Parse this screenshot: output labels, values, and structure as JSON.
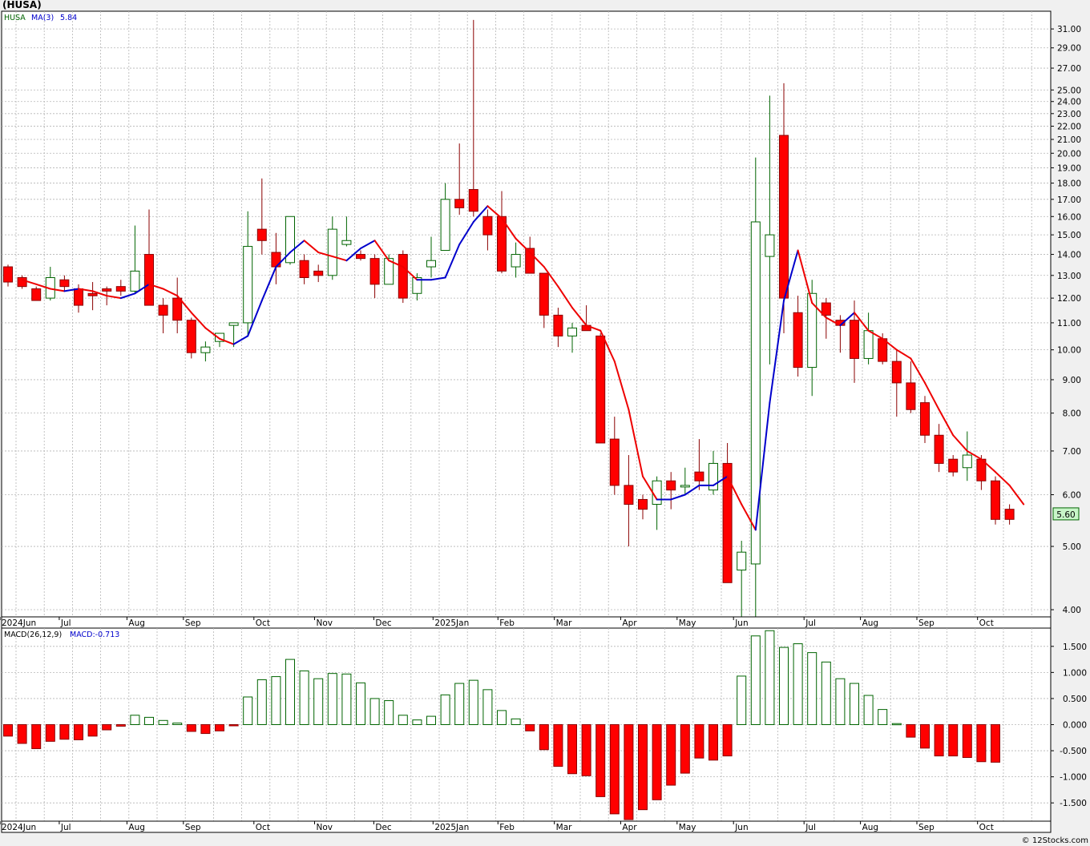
{
  "header": {
    "ticker_title": "(HUSA)"
  },
  "footer": {
    "copyright": "© 12Stocks.com"
  },
  "colors": {
    "up": "#006400",
    "down": "#ff0000",
    "ma_up": "#0000cc",
    "ma_down": "#ee0000",
    "grid": "#b5b5b5",
    "bg": "#ffffff"
  },
  "chart_data": [
    {
      "type": "candlestick",
      "legend": {
        "symbol": "HUSA",
        "ma_label": "MA(3)",
        "ma_value": "5.84"
      },
      "last_price_label": "5.60",
      "scale": "log",
      "ylim": [
        3.9,
        33
      ],
      "y_ticks": [
        "4.00",
        "5.00",
        "6.00",
        "7.00",
        "8.00",
        "9.00",
        "10.00",
        "11.00",
        "12.00",
        "13.00",
        "14.00",
        "15.00",
        "16.00",
        "17.00",
        "18.00",
        "19.00",
        "20.00",
        "21.00",
        "22.00",
        "23.00",
        "24.00",
        "25.00",
        "27.00",
        "29.00",
        "31.00"
      ],
      "x_labels": [
        "2024Jun",
        "Jul",
        "Aug",
        "Sep",
        "Oct",
        "Nov",
        "Dec",
        "2025Jan",
        "Feb",
        "Mar",
        "Apr",
        "May",
        "Jun",
        "Jul",
        "Aug",
        "Sep",
        "Oct"
      ],
      "candles": [
        {
          "o": 13.4,
          "h": 13.5,
          "l": 12.5,
          "c": 12.7
        },
        {
          "o": 12.9,
          "h": 13.0,
          "l": 12.4,
          "c": 12.5
        },
        {
          "o": 12.4,
          "h": 12.5,
          "l": 11.9,
          "c": 11.9
        },
        {
          "o": 12.0,
          "h": 13.4,
          "l": 11.9,
          "c": 12.9
        },
        {
          "o": 12.8,
          "h": 13.0,
          "l": 12.3,
          "c": 12.5
        },
        {
          "o": 12.4,
          "h": 12.6,
          "l": 11.4,
          "c": 11.7
        },
        {
          "o": 12.2,
          "h": 12.7,
          "l": 11.5,
          "c": 12.1
        },
        {
          "o": 12.4,
          "h": 12.5,
          "l": 11.7,
          "c": 12.3
        },
        {
          "o": 12.5,
          "h": 12.8,
          "l": 12.1,
          "c": 12.3
        },
        {
          "o": 12.3,
          "h": 15.5,
          "l": 12.2,
          "c": 13.2
        },
        {
          "o": 14.0,
          "h": 16.4,
          "l": 11.7,
          "c": 11.7
        },
        {
          "o": 11.7,
          "h": 12.0,
          "l": 10.6,
          "c": 11.3
        },
        {
          "o": 12.0,
          "h": 12.9,
          "l": 10.6,
          "c": 11.1
        },
        {
          "o": 11.1,
          "h": 11.2,
          "l": 9.7,
          "c": 9.9
        },
        {
          "o": 9.9,
          "h": 10.3,
          "l": 9.6,
          "c": 10.1
        },
        {
          "o": 10.3,
          "h": 10.6,
          "l": 10.1,
          "c": 10.6
        },
        {
          "o": 10.9,
          "h": 11.0,
          "l": 10.1,
          "c": 11.0
        },
        {
          "o": 11.0,
          "h": 16.3,
          "l": 10.5,
          "c": 14.4
        },
        {
          "o": 15.3,
          "h": 18.3,
          "l": 14.0,
          "c": 14.7
        },
        {
          "o": 14.1,
          "h": 15.1,
          "l": 12.6,
          "c": 13.4
        },
        {
          "o": 13.6,
          "h": 16.0,
          "l": 13.5,
          "c": 16.0
        },
        {
          "o": 13.7,
          "h": 14.0,
          "l": 12.6,
          "c": 12.9
        },
        {
          "o": 13.2,
          "h": 13.5,
          "l": 12.7,
          "c": 13.0
        },
        {
          "o": 13.0,
          "h": 16.0,
          "l": 12.8,
          "c": 15.3
        },
        {
          "o": 14.5,
          "h": 16.0,
          "l": 14.4,
          "c": 14.7
        },
        {
          "o": 14.0,
          "h": 14.2,
          "l": 13.7,
          "c": 13.8
        },
        {
          "o": 13.8,
          "h": 14.0,
          "l": 12.0,
          "c": 12.6
        },
        {
          "o": 12.6,
          "h": 14.0,
          "l": 12.6,
          "c": 13.8
        },
        {
          "o": 14.0,
          "h": 14.2,
          "l": 11.8,
          "c": 12.0
        },
        {
          "o": 12.2,
          "h": 13.1,
          "l": 11.9,
          "c": 12.9
        },
        {
          "o": 13.4,
          "h": 14.9,
          "l": 12.9,
          "c": 13.7
        },
        {
          "o": 14.2,
          "h": 18.0,
          "l": 14.2,
          "c": 17.0
        },
        {
          "o": 17.0,
          "h": 20.7,
          "l": 16.1,
          "c": 16.5
        },
        {
          "o": 17.6,
          "h": 32.0,
          "l": 16.0,
          "c": 16.3
        },
        {
          "o": 16.0,
          "h": 16.4,
          "l": 14.2,
          "c": 15.0
        },
        {
          "o": 16.0,
          "h": 17.5,
          "l": 13.1,
          "c": 13.2
        },
        {
          "o": 13.4,
          "h": 14.6,
          "l": 12.9,
          "c": 14.0
        },
        {
          "o": 14.3,
          "h": 14.9,
          "l": 13.1,
          "c": 13.1
        },
        {
          "o": 13.1,
          "h": 13.1,
          "l": 10.8,
          "c": 11.3
        },
        {
          "o": 11.3,
          "h": 11.6,
          "l": 10.1,
          "c": 10.5
        },
        {
          "o": 10.5,
          "h": 11.0,
          "l": 9.9,
          "c": 10.8
        },
        {
          "o": 10.9,
          "h": 11.7,
          "l": 10.7,
          "c": 10.7
        },
        {
          "o": 10.5,
          "h": 10.6,
          "l": 7.2,
          "c": 7.2
        },
        {
          "o": 7.3,
          "h": 7.9,
          "l": 6.0,
          "c": 6.2
        },
        {
          "o": 6.2,
          "h": 6.9,
          "l": 5.0,
          "c": 5.8
        },
        {
          "o": 5.9,
          "h": 6.0,
          "l": 5.5,
          "c": 5.7
        },
        {
          "o": 5.8,
          "h": 6.4,
          "l": 5.3,
          "c": 6.3
        },
        {
          "o": 6.3,
          "h": 6.5,
          "l": 5.7,
          "c": 6.1
        },
        {
          "o": 6.2,
          "h": 6.6,
          "l": 6.0,
          "c": 6.2
        },
        {
          "o": 6.5,
          "h": 7.3,
          "l": 6.1,
          "c": 6.3
        },
        {
          "o": 6.1,
          "h": 7.0,
          "l": 6.0,
          "c": 6.7
        },
        {
          "o": 6.7,
          "h": 7.2,
          "l": 4.4,
          "c": 4.4
        },
        {
          "o": 4.6,
          "h": 5.1,
          "l": 3.9,
          "c": 4.9
        },
        {
          "o": 4.7,
          "h": 19.7,
          "l": 3.9,
          "c": 15.7
        },
        {
          "o": 13.9,
          "h": 24.5,
          "l": 9.5,
          "c": 15.0
        },
        {
          "o": 21.3,
          "h": 25.6,
          "l": 10.6,
          "c": 12.0
        },
        {
          "o": 11.4,
          "h": 12.1,
          "l": 9.1,
          "c": 9.4
        },
        {
          "o": 9.4,
          "h": 12.8,
          "l": 8.5,
          "c": 12.2
        },
        {
          "o": 11.8,
          "h": 12.0,
          "l": 10.4,
          "c": 11.3
        },
        {
          "o": 11.1,
          "h": 11.3,
          "l": 9.9,
          "c": 10.9
        },
        {
          "o": 11.1,
          "h": 11.9,
          "l": 8.9,
          "c": 9.7
        },
        {
          "o": 9.7,
          "h": 11.4,
          "l": 9.5,
          "c": 10.7
        },
        {
          "o": 10.4,
          "h": 10.6,
          "l": 9.5,
          "c": 9.6
        },
        {
          "o": 9.6,
          "h": 10.0,
          "l": 7.9,
          "c": 8.9
        },
        {
          "o": 8.9,
          "h": 9.6,
          "l": 8.0,
          "c": 8.1
        },
        {
          "o": 8.3,
          "h": 8.5,
          "l": 7.2,
          "c": 7.4
        },
        {
          "o": 7.4,
          "h": 7.7,
          "l": 6.5,
          "c": 6.7
        },
        {
          "o": 6.8,
          "h": 6.9,
          "l": 6.4,
          "c": 6.5
        },
        {
          "o": 6.6,
          "h": 7.5,
          "l": 6.3,
          "c": 6.9
        },
        {
          "o": 6.8,
          "h": 6.9,
          "l": 6.1,
          "c": 6.3
        },
        {
          "o": 6.3,
          "h": 6.4,
          "l": 5.4,
          "c": 5.5
        },
        {
          "o": 5.7,
          "h": 5.8,
          "l": 5.4,
          "c": 5.5
        }
      ],
      "ma": [
        12.8,
        12.6,
        12.4,
        12.3,
        12.4,
        12.3,
        12.1,
        12.0,
        12.2,
        12.6,
        12.4,
        12.1,
        11.4,
        10.8,
        10.4,
        10.2,
        10.5,
        11.9,
        13.4,
        14.1,
        14.7,
        14.1,
        13.9,
        13.7,
        14.3,
        14.7,
        13.7,
        13.4,
        12.8,
        12.8,
        12.9,
        14.5,
        15.7,
        16.6,
        15.9,
        14.8,
        14.1,
        13.4,
        12.5,
        11.6,
        10.9,
        10.7,
        9.6,
        8.1,
        6.4,
        5.9,
        5.9,
        6.0,
        6.2,
        6.2,
        6.4,
        5.8,
        5.3,
        8.3,
        11.9,
        14.2,
        11.8,
        11.2,
        10.9,
        11.4,
        10.7,
        10.4,
        10.0,
        9.7,
        8.9,
        8.1,
        7.4,
        7.0,
        6.8,
        6.5,
        6.2,
        5.8
      ]
    },
    {
      "type": "bar",
      "legend": {
        "name": "MACD(26,12,9)",
        "value_label": "MACD:-0.713"
      },
      "ylim": [
        -1.85,
        1.85
      ],
      "y_ticks": [
        "1.500",
        "1.000",
        "0.500",
        "0.000",
        "-0.500",
        "-1.000",
        "-1.500"
      ],
      "x_labels": [
        "2024Jun",
        "Jul",
        "Aug",
        "Sep",
        "Oct",
        "Nov",
        "Dec",
        "2025Jan",
        "Feb",
        "Mar",
        "Apr",
        "May",
        "Jun",
        "Jul",
        "Aug",
        "Sep",
        "Oct"
      ],
      "values": [
        -0.22,
        -0.36,
        -0.46,
        -0.32,
        -0.28,
        -0.29,
        -0.22,
        -0.1,
        -0.03,
        0.18,
        0.14,
        0.08,
        0.03,
        -0.13,
        -0.17,
        -0.12,
        -0.02,
        0.53,
        0.86,
        0.92,
        1.25,
        1.03,
        0.88,
        0.98,
        0.97,
        0.8,
        0.5,
        0.46,
        0.18,
        0.09,
        0.16,
        0.57,
        0.79,
        0.85,
        0.67,
        0.27,
        0.11,
        -0.12,
        -0.48,
        -0.8,
        -0.94,
        -0.98,
        -1.38,
        -1.71,
        -1.82,
        -1.63,
        -1.44,
        -1.16,
        -0.93,
        -0.64,
        -0.68,
        -0.6,
        0.93,
        1.7,
        1.8,
        1.48,
        1.55,
        1.38,
        1.2,
        0.88,
        0.79,
        0.56,
        0.29,
        0.02,
        -0.24,
        -0.45,
        -0.6,
        -0.6,
        -0.63,
        -0.71,
        -0.72
      ]
    }
  ]
}
